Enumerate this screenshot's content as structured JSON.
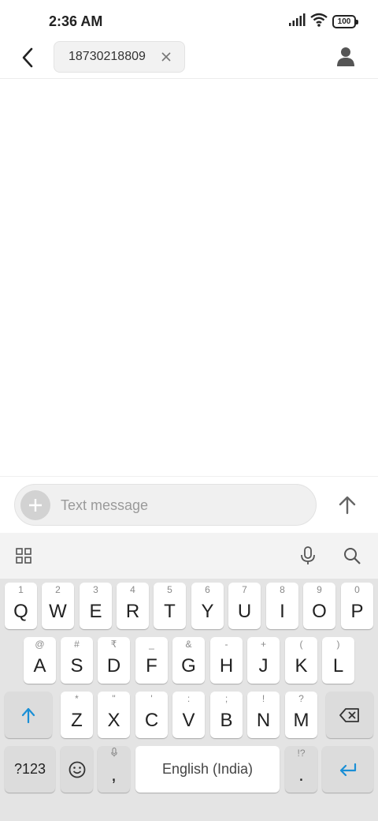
{
  "status_bar": {
    "time": "2:36 AM",
    "battery": "100"
  },
  "header": {
    "recipient": "18730218809"
  },
  "compose": {
    "placeholder": "Text message"
  },
  "keyboard": {
    "row1": [
      {
        "key": "Q",
        "hint": "1"
      },
      {
        "key": "W",
        "hint": "2"
      },
      {
        "key": "E",
        "hint": "3"
      },
      {
        "key": "R",
        "hint": "4"
      },
      {
        "key": "T",
        "hint": "5"
      },
      {
        "key": "Y",
        "hint": "6"
      },
      {
        "key": "U",
        "hint": "7"
      },
      {
        "key": "I",
        "hint": "8"
      },
      {
        "key": "O",
        "hint": "9"
      },
      {
        "key": "P",
        "hint": "0"
      }
    ],
    "row2": [
      {
        "key": "A",
        "hint": "@"
      },
      {
        "key": "S",
        "hint": "#"
      },
      {
        "key": "D",
        "hint": "₹"
      },
      {
        "key": "F",
        "hint": "_"
      },
      {
        "key": "G",
        "hint": "&"
      },
      {
        "key": "H",
        "hint": "-"
      },
      {
        "key": "J",
        "hint": "+"
      },
      {
        "key": "K",
        "hint": "("
      },
      {
        "key": "L",
        "hint": ")"
      }
    ],
    "row3": [
      {
        "key": "Z",
        "hint": "*"
      },
      {
        "key": "X",
        "hint": "\""
      },
      {
        "key": "C",
        "hint": "'"
      },
      {
        "key": "V",
        "hint": ":"
      },
      {
        "key": "B",
        "hint": ";"
      },
      {
        "key": "N",
        "hint": "!"
      },
      {
        "key": "M",
        "hint": "?"
      }
    ],
    "symbols_label": "?123",
    "comma": ",",
    "space_label": "English (India)",
    "period": ".",
    "period_hint": "!?"
  },
  "colors": {
    "accent": "#1a8fd6",
    "keyboard_bg": "#e4e4e4"
  }
}
